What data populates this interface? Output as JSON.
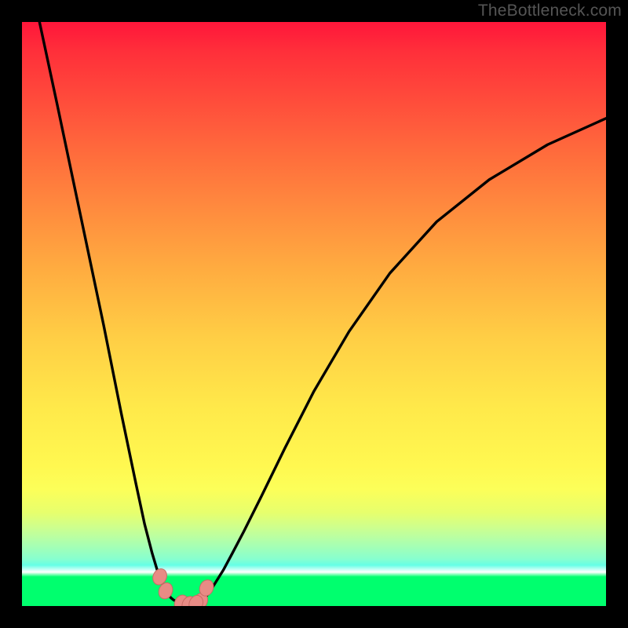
{
  "watermark": "TheBottleneck.com",
  "chart_data": {
    "type": "line",
    "title": "",
    "xlabel": "",
    "ylabel": "",
    "xlim": [
      0,
      100
    ],
    "ylim": [
      0,
      100
    ],
    "grid": false,
    "legend": false,
    "series": [
      {
        "name": "left-curve",
        "x": [
          3,
          6,
          10,
          14,
          17,
          19.5,
          21,
          22.3,
          23.2,
          24.0,
          24.6,
          25.1,
          25.5,
          26.0,
          26.5,
          27.2
        ],
        "values": [
          100,
          86,
          67,
          48,
          33,
          21,
          14,
          9.0,
          6.0,
          4.0,
          2.7,
          1.9,
          1.4,
          1.0,
          0.8,
          0.74
        ]
      },
      {
        "name": "right-curve",
        "x": [
          30.0,
          30.6,
          31.2,
          32.0,
          33.0,
          34.5,
          36.0,
          38.0,
          41.0,
          45.0,
          50.0,
          56.0,
          63.0,
          71.0,
          80.0,
          90.0,
          100.0
        ],
        "values": [
          0.74,
          0.85,
          1.3,
          2.2,
          3.8,
          6.2,
          9.0,
          12.8,
          18.8,
          27.0,
          36.8,
          47.0,
          57.0,
          65.8,
          73.0,
          79.0,
          83.5
        ]
      },
      {
        "name": "floor-segment",
        "x": [
          27.2,
          27.8,
          28.4,
          29.0,
          29.6,
          30.0
        ],
        "values": [
          0.74,
          0.7,
          0.68,
          0.68,
          0.7,
          0.74
        ]
      }
    ],
    "markers": [
      {
        "name": "left-marker-a",
        "x": 23.6,
        "y": 5.0
      },
      {
        "name": "left-marker-b",
        "x": 24.6,
        "y": 2.6
      },
      {
        "name": "right-marker-a",
        "x": 30.6,
        "y": 0.85
      },
      {
        "name": "right-marker-b",
        "x": 31.6,
        "y": 3.1
      },
      {
        "name": "floor-marker-a",
        "x": 27.3,
        "y": 0.5
      },
      {
        "name": "floor-marker-b",
        "x": 28.6,
        "y": 0.28
      },
      {
        "name": "floor-marker-c",
        "x": 29.8,
        "y": 0.45
      }
    ],
    "colors": {
      "curve_stroke": "#000000",
      "marker_fill": "#e88b85",
      "marker_stroke": "#c96b65"
    }
  }
}
